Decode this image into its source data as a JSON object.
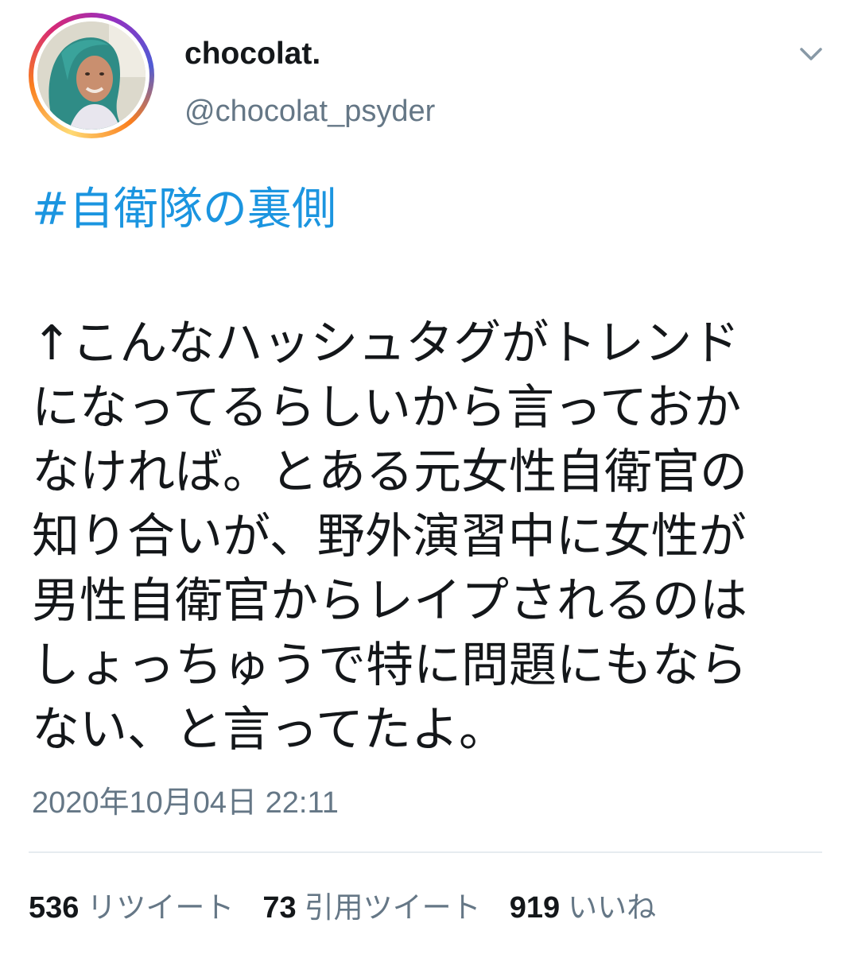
{
  "author": {
    "display_name": "chocolat.",
    "handle": "@chocolat_psyder"
  },
  "header": {
    "menu_icon": "chevron-down-icon"
  },
  "tweet": {
    "hashtag": "#自衛隊の裏側",
    "lines": [
      "↑こんなハッシュタグがトレンド",
      "になってるらしいから言っておか",
      "なければ。とある元女性自衛官の",
      "知り合いが、野外演習中に女性が",
      "男性自衛官からレイプされるのは",
      "しょっちゅうで特に問題にもなら",
      "ない、と言ってたよ。"
    ],
    "timestamp": "2020年10月04日 22:11"
  },
  "stats": {
    "retweets": {
      "count": "536",
      "label": "リツイート"
    },
    "quotes": {
      "count": "73",
      "label": "引用ツイート"
    },
    "likes": {
      "count": "919",
      "label": "いいね"
    }
  },
  "colors": {
    "hashtag": "#1b95e0",
    "secondary_text": "#657786",
    "primary_text": "#14171a",
    "divider": "#e6ecf0"
  }
}
